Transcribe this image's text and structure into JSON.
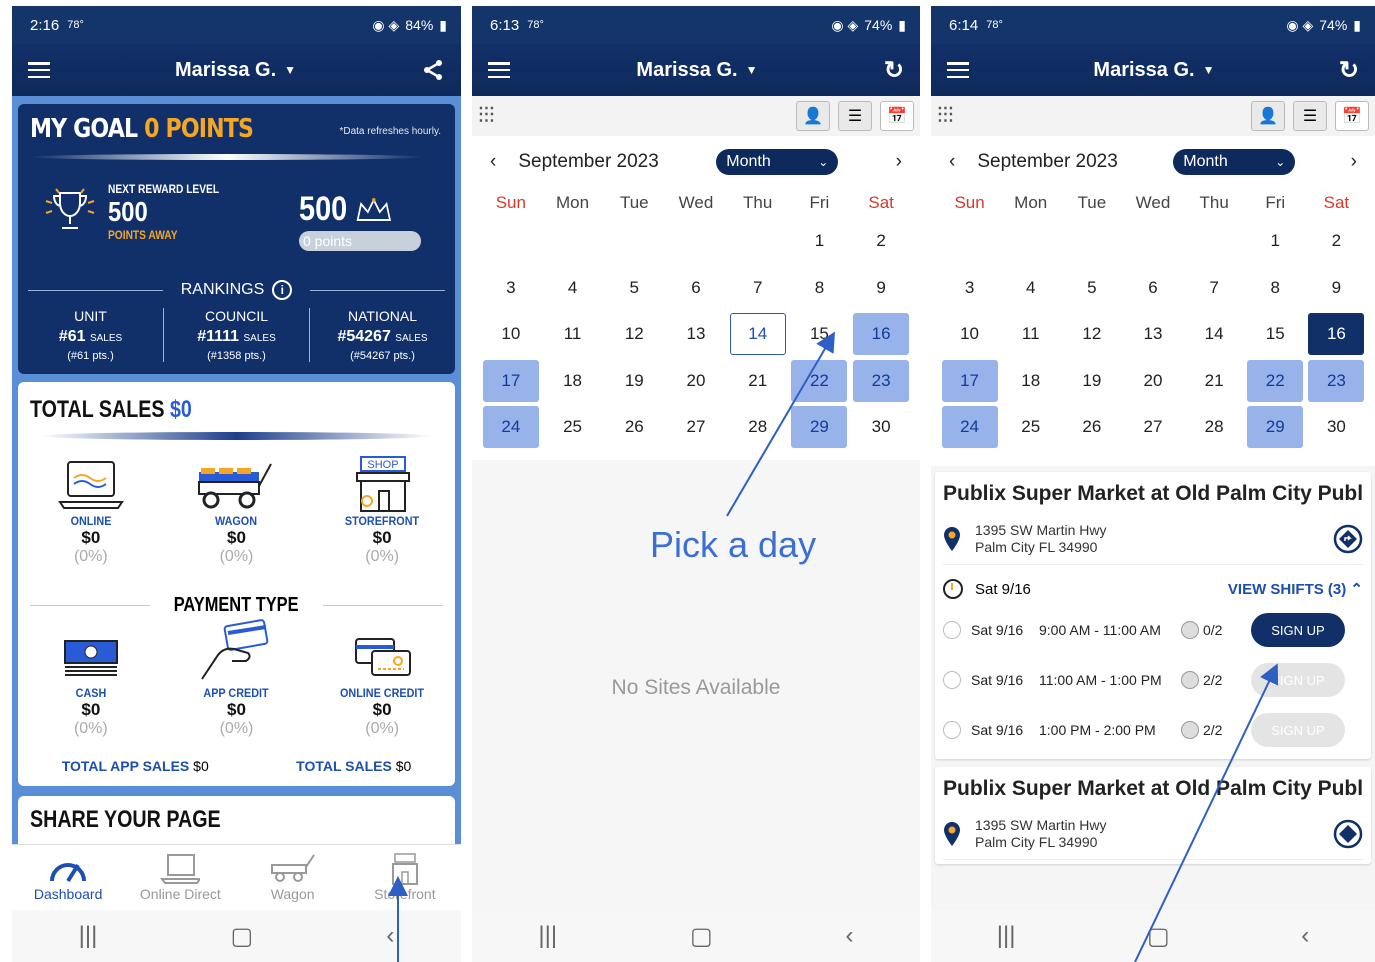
{
  "p1": {
    "status": {
      "time": "2:16",
      "temp": "78°",
      "battery": "84%"
    },
    "header": {
      "user": "Marissa G."
    },
    "goal": {
      "title": "MY GOAL",
      "points": "0 POINTS",
      "refresh": "*Data refreshes hourly.",
      "next_label": "NEXT REWARD LEVEL",
      "next_value": "500",
      "away": "POINTS AWAY",
      "target": "500",
      "progress_text": "0 points",
      "progress_fraction": 0
    },
    "rankings": {
      "title": "RANKINGS",
      "items": [
        {
          "label": "UNIT",
          "value": "#61",
          "unit": "SALES",
          "pts": "(#61 pts.)"
        },
        {
          "label": "COUNCIL",
          "value": "#1111",
          "unit": "SALES",
          "pts": "(#1358 pts.)"
        },
        {
          "label": "NATIONAL",
          "value": "#54267",
          "unit": "SALES",
          "pts": "(#54267 pts.)"
        }
      ]
    },
    "sales": {
      "title": "TOTAL SALES",
      "amount": "$0",
      "channels": [
        {
          "name": "ONLINE",
          "amount": "$0",
          "pct": "(0%)"
        },
        {
          "name": "WAGON",
          "amount": "$0",
          "pct": "(0%)"
        },
        {
          "name": "STOREFRONT",
          "amount": "$0",
          "pct": "(0%)"
        }
      ],
      "payment_title": "PAYMENT TYPE",
      "payments": [
        {
          "name": "CASH",
          "amount": "$0",
          "pct": "(0%)"
        },
        {
          "name": "APP CREDIT",
          "amount": "$0",
          "pct": "(0%)"
        },
        {
          "name": "ONLINE CREDIT",
          "amount": "$0",
          "pct": "(0%)"
        }
      ],
      "total_app_label": "TOTAL APP SALES",
      "total_app": "$0",
      "total_label": "TOTAL SALES",
      "total": "$0"
    },
    "share_title": "SHARE YOUR PAGE",
    "shop_sign": "SHOP",
    "nav": [
      "Dashboard",
      "Online Direct",
      "Wagon",
      "Storefront"
    ]
  },
  "p2": {
    "status": {
      "time": "6:13",
      "temp": "78°",
      "battery": "74%"
    },
    "header": {
      "user": "Marissa G."
    },
    "calendar": {
      "month": "September 2023",
      "view": "Month"
    },
    "empty": "No Sites Available",
    "annotation": "Pick a day"
  },
  "p3": {
    "status": {
      "time": "6:14",
      "temp": "78°",
      "battery": "74%"
    },
    "header": {
      "user": "Marissa G."
    },
    "calendar": {
      "month": "September 2023",
      "view": "Month"
    },
    "sites": [
      {
        "name": "Publix Super Market at Old Palm City Publ",
        "address1": "1395 SW Martin Hwy",
        "address2": "Palm City FL 34990",
        "day": "Sat 9/16",
        "view_shifts": "VIEW SHIFTS (3)",
        "shifts": [
          {
            "date": "Sat 9/16",
            "time": "9:00 AM - 11:00 AM",
            "count": "0/2",
            "action": "SIGN UP",
            "enabled": true
          },
          {
            "date": "Sat 9/16",
            "time": "11:00 AM - 1:00 PM",
            "count": "2/2",
            "action": "SIGN UP",
            "enabled": false
          },
          {
            "date": "Sat 9/16",
            "time": "1:00 PM - 2:00 PM",
            "count": "2/2",
            "action": "SIGN UP",
            "enabled": false
          }
        ]
      },
      {
        "name": "Publix Super Market at Old Palm City Publ",
        "address1": "1395 SW Martin Hwy",
        "address2": "Palm City FL 34990"
      }
    ]
  },
  "weekdays": [
    "Sun",
    "Mon",
    "Tue",
    "Wed",
    "Thu",
    "Fri",
    "Sat"
  ],
  "days": [
    "",
    "",
    "",
    "",
    "",
    "1",
    "2",
    "3",
    "4",
    "5",
    "6",
    "7",
    "8",
    "9",
    "10",
    "11",
    "12",
    "13",
    "14",
    "15",
    "16",
    "17",
    "18",
    "19",
    "20",
    "21",
    "22",
    "23",
    "24",
    "25",
    "26",
    "27",
    "28",
    "29",
    "30"
  ],
  "colors": {
    "navy": "#123068",
    "accent_blue": "#1d4fb0",
    "highlight": "#97b3ea",
    "orange": "#f5a623",
    "weekend_red": "#d8382c"
  }
}
